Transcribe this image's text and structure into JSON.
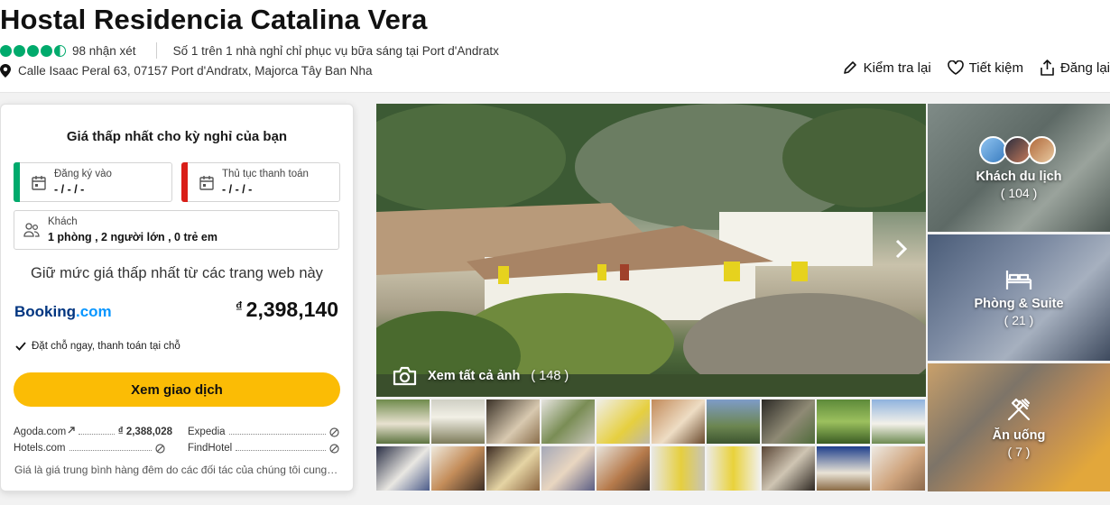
{
  "hotel": {
    "name": "Hostal Residencia Catalina Vera",
    "rating_bubbles": 4.5,
    "reviews": "98 nhận xét",
    "ranking": "Số 1 trên 1 nhà nghỉ chỉ phục vụ bữa sáng tại Port d'Andratx",
    "address": "Calle Isaac Peral 63, 07157 Port d'Andratx, Majorca Tây Ban Nha"
  },
  "actions": {
    "review": "Kiểm tra lại",
    "save": "Tiết kiệm",
    "share": "Đăng lại"
  },
  "booking": {
    "title": "Giá thấp nhất cho kỳ nghỉ của bạn",
    "checkin_label": "Đăng ký vào",
    "checkin_value": "- / - / -",
    "checkout_label": "Thủ tục thanh toán",
    "checkout_value": "- / - / -",
    "guests_label": "Khách",
    "guests_value": "1 phòng , 2 người lớn , 0 trẻ em",
    "keep_price": "Giữ mức giá thấp nhất từ các trang web này",
    "provider": "Booking",
    "provider_suffix": ".com",
    "currency": "₫",
    "price": "2,398,140",
    "benefit": "Đặt chỗ ngay, thanh toán tại chỗ",
    "deal_button": "Xem giao dịch",
    "partners": [
      {
        "name": "Agoda.com",
        "price": "₫ 2,388,028"
      },
      {
        "name": "Expedia",
        "price": ""
      },
      {
        "name": "Hotels.com",
        "price": ""
      },
      {
        "name": "FindHotel",
        "price": ""
      }
    ],
    "footnote": "Giá là giá trung bình hàng đêm do các đối tác của chúng tôi cung cấp"
  },
  "photos": {
    "all_label": "Xem tất cả ảnh",
    "all_count": "( 148 )",
    "tiles": [
      {
        "label": "Khách du lịch",
        "count": "( 104 )"
      },
      {
        "label": "Phòng & Suite",
        "count": "( 21 )"
      },
      {
        "label": "Ăn uống",
        "count": "( 7 )"
      }
    ]
  },
  "colors": {
    "bubble": "#00aa6c",
    "checkin_stripe": "#00aa6c",
    "checkout_stripe": "#d91e18",
    "deal_button": "#fbbc05",
    "booking_brand": "#003580"
  }
}
